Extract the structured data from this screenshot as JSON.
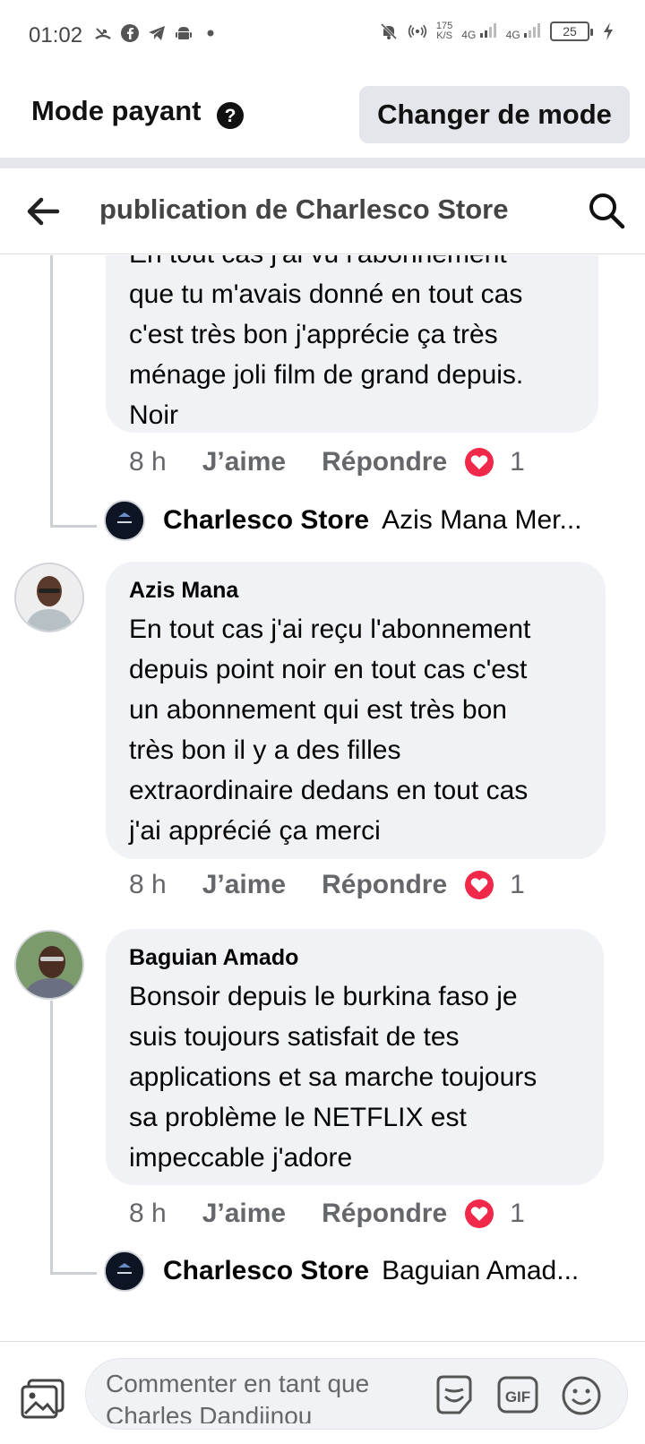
{
  "status_bar": {
    "time": "01:02",
    "speed_top": "175",
    "speed_bottom": "K/S",
    "net1": "4G",
    "net2": "4G",
    "battery": "25"
  },
  "mode_bar": {
    "title": "Mode payant",
    "change_label": "Changer de mode"
  },
  "header": {
    "title": "publication de Charlesco Store"
  },
  "comments": [
    {
      "text_lines": [
        "En tout cas j'ai vu l'abonnement",
        "que tu m'avais donné en tout cas",
        "c'est très bon j'apprécie ça très",
        "ménage joli film de grand depuis.",
        "Noir"
      ],
      "time": "8 h",
      "like": "J’aime",
      "reply": "Répondre",
      "reaction_count": "1",
      "reply_preview": {
        "name": "Charlesco Store",
        "snippet": "Azis Mana Mer..."
      }
    },
    {
      "author": "Azis Mana",
      "text_lines": [
        "En tout cas j'ai reçu l'abonnement",
        "depuis point noir en tout cas c'est",
        "un abonnement qui est très bon",
        "très bon il y a des filles",
        "extraordinaire dedans en tout cas",
        "j'ai apprécié ça merci"
      ],
      "time": "8 h",
      "like": "J’aime",
      "reply": "Répondre",
      "reaction_count": "1"
    },
    {
      "author": "Baguian Amado",
      "text_lines": [
        "Bonsoir depuis le burkina faso je",
        "suis toujours satisfait de tes",
        "applications et sa marche toujours",
        "sa problème le NETFLIX est",
        "impeccable j'adore"
      ],
      "time": "8 h",
      "like": "J’aime",
      "reply": "Répondre",
      "reaction_count": "1",
      "reply_preview": {
        "name": "Charlesco Store",
        "snippet": "Baguian Amad..."
      }
    }
  ],
  "bottom_bar": {
    "placeholder_line1": "Commenter en tant que",
    "placeholder_line2": "Charles Dandjinou",
    "gif_label": "GIF"
  },
  "colors": {
    "accent_heart": "#f02849",
    "bubble_bg": "#f0f2f5",
    "muted_text": "#65676b"
  }
}
